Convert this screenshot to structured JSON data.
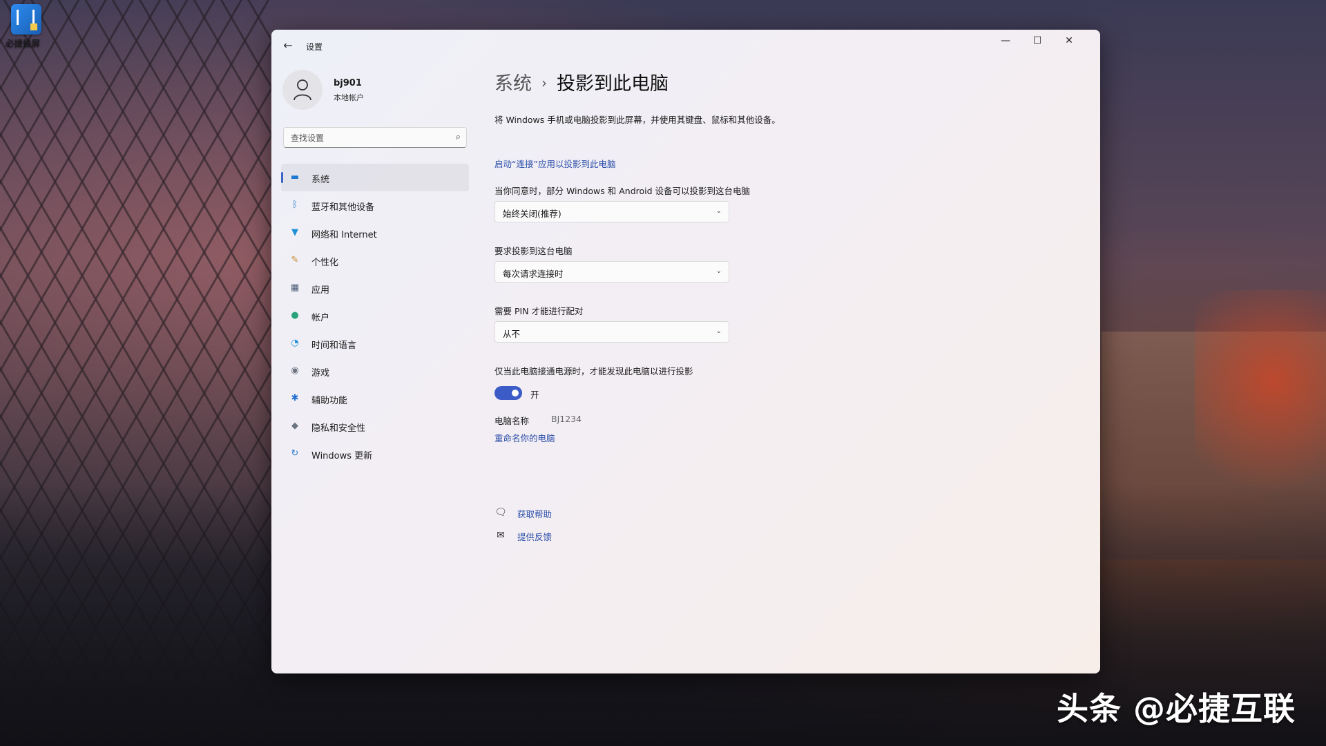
{
  "desktop": {
    "icon_label": "必捷投屏"
  },
  "window": {
    "app_title": "设置",
    "back_glyph": "←",
    "min_glyph": "—",
    "max_glyph": "☐",
    "close_glyph": "✕"
  },
  "user": {
    "name": "bj901",
    "account_type": "本地帐户"
  },
  "search": {
    "placeholder": "查找设置",
    "icon_glyph": "⌕"
  },
  "sidebar": {
    "items": [
      {
        "label": "系统",
        "icon": "system-icon",
        "glyph": "▬",
        "color": "#1f78d1",
        "active": true
      },
      {
        "label": "蓝牙和其他设备",
        "icon": "bluetooth-icon",
        "glyph": "ᛒ",
        "color": "#1f78d1"
      },
      {
        "label": "网络和 Internet",
        "icon": "wifi-icon",
        "glyph": "▼",
        "color": "#1f8fd6"
      },
      {
        "label": "个性化",
        "icon": "brush-icon",
        "glyph": "✎",
        "color": "#c98a2c"
      },
      {
        "label": "应用",
        "icon": "apps-icon",
        "glyph": "▦",
        "color": "#4a5a75"
      },
      {
        "label": "帐户",
        "icon": "account-icon",
        "glyph": "●",
        "color": "#2aa37a"
      },
      {
        "label": "时间和语言",
        "icon": "globe-clock-icon",
        "glyph": "◔",
        "color": "#1f8fd6"
      },
      {
        "label": "游戏",
        "icon": "gamepad-icon",
        "glyph": "◉",
        "color": "#6b7280"
      },
      {
        "label": "辅助功能",
        "icon": "accessibility-icon",
        "glyph": "✱",
        "color": "#1f6fd1"
      },
      {
        "label": "隐私和安全性",
        "icon": "shield-icon",
        "glyph": "◆",
        "color": "#6b7280"
      },
      {
        "label": "Windows 更新",
        "icon": "update-icon",
        "glyph": "↻",
        "color": "#1f78d1"
      }
    ]
  },
  "main": {
    "breadcrumb_parent": "系统",
    "breadcrumb_sep": "›",
    "breadcrumb_current": "投影到此电脑",
    "description": "将 Windows 手机或电脑投影到此屏幕，并使用其键盘、鼠标和其他设备。",
    "connect_link": "启动“连接”应用以投影到此电脑",
    "setting1_label": "当你同意时，部分 Windows 和 Android 设备可以投影到这台电脑",
    "setting1_value": "始终关闭(推荐)",
    "setting2_label": "要求投影到这台电脑",
    "setting2_value": "每次请求连接时",
    "setting3_label": "需要 PIN 才能进行配对",
    "setting3_value": "从不",
    "setting4_label": "仅当此电脑接通电源时，才能发现此电脑以进行投影",
    "toggle_state": "开",
    "toggle_on": true,
    "pc_name_label": "电脑名称",
    "pc_name_value": "BJ1234",
    "rename_link": "重命名你的电脑",
    "chevron_glyph": "⌄",
    "get_help": "获取帮助",
    "feedback": "提供反馈"
  },
  "watermark": "头条 @必捷互联"
}
